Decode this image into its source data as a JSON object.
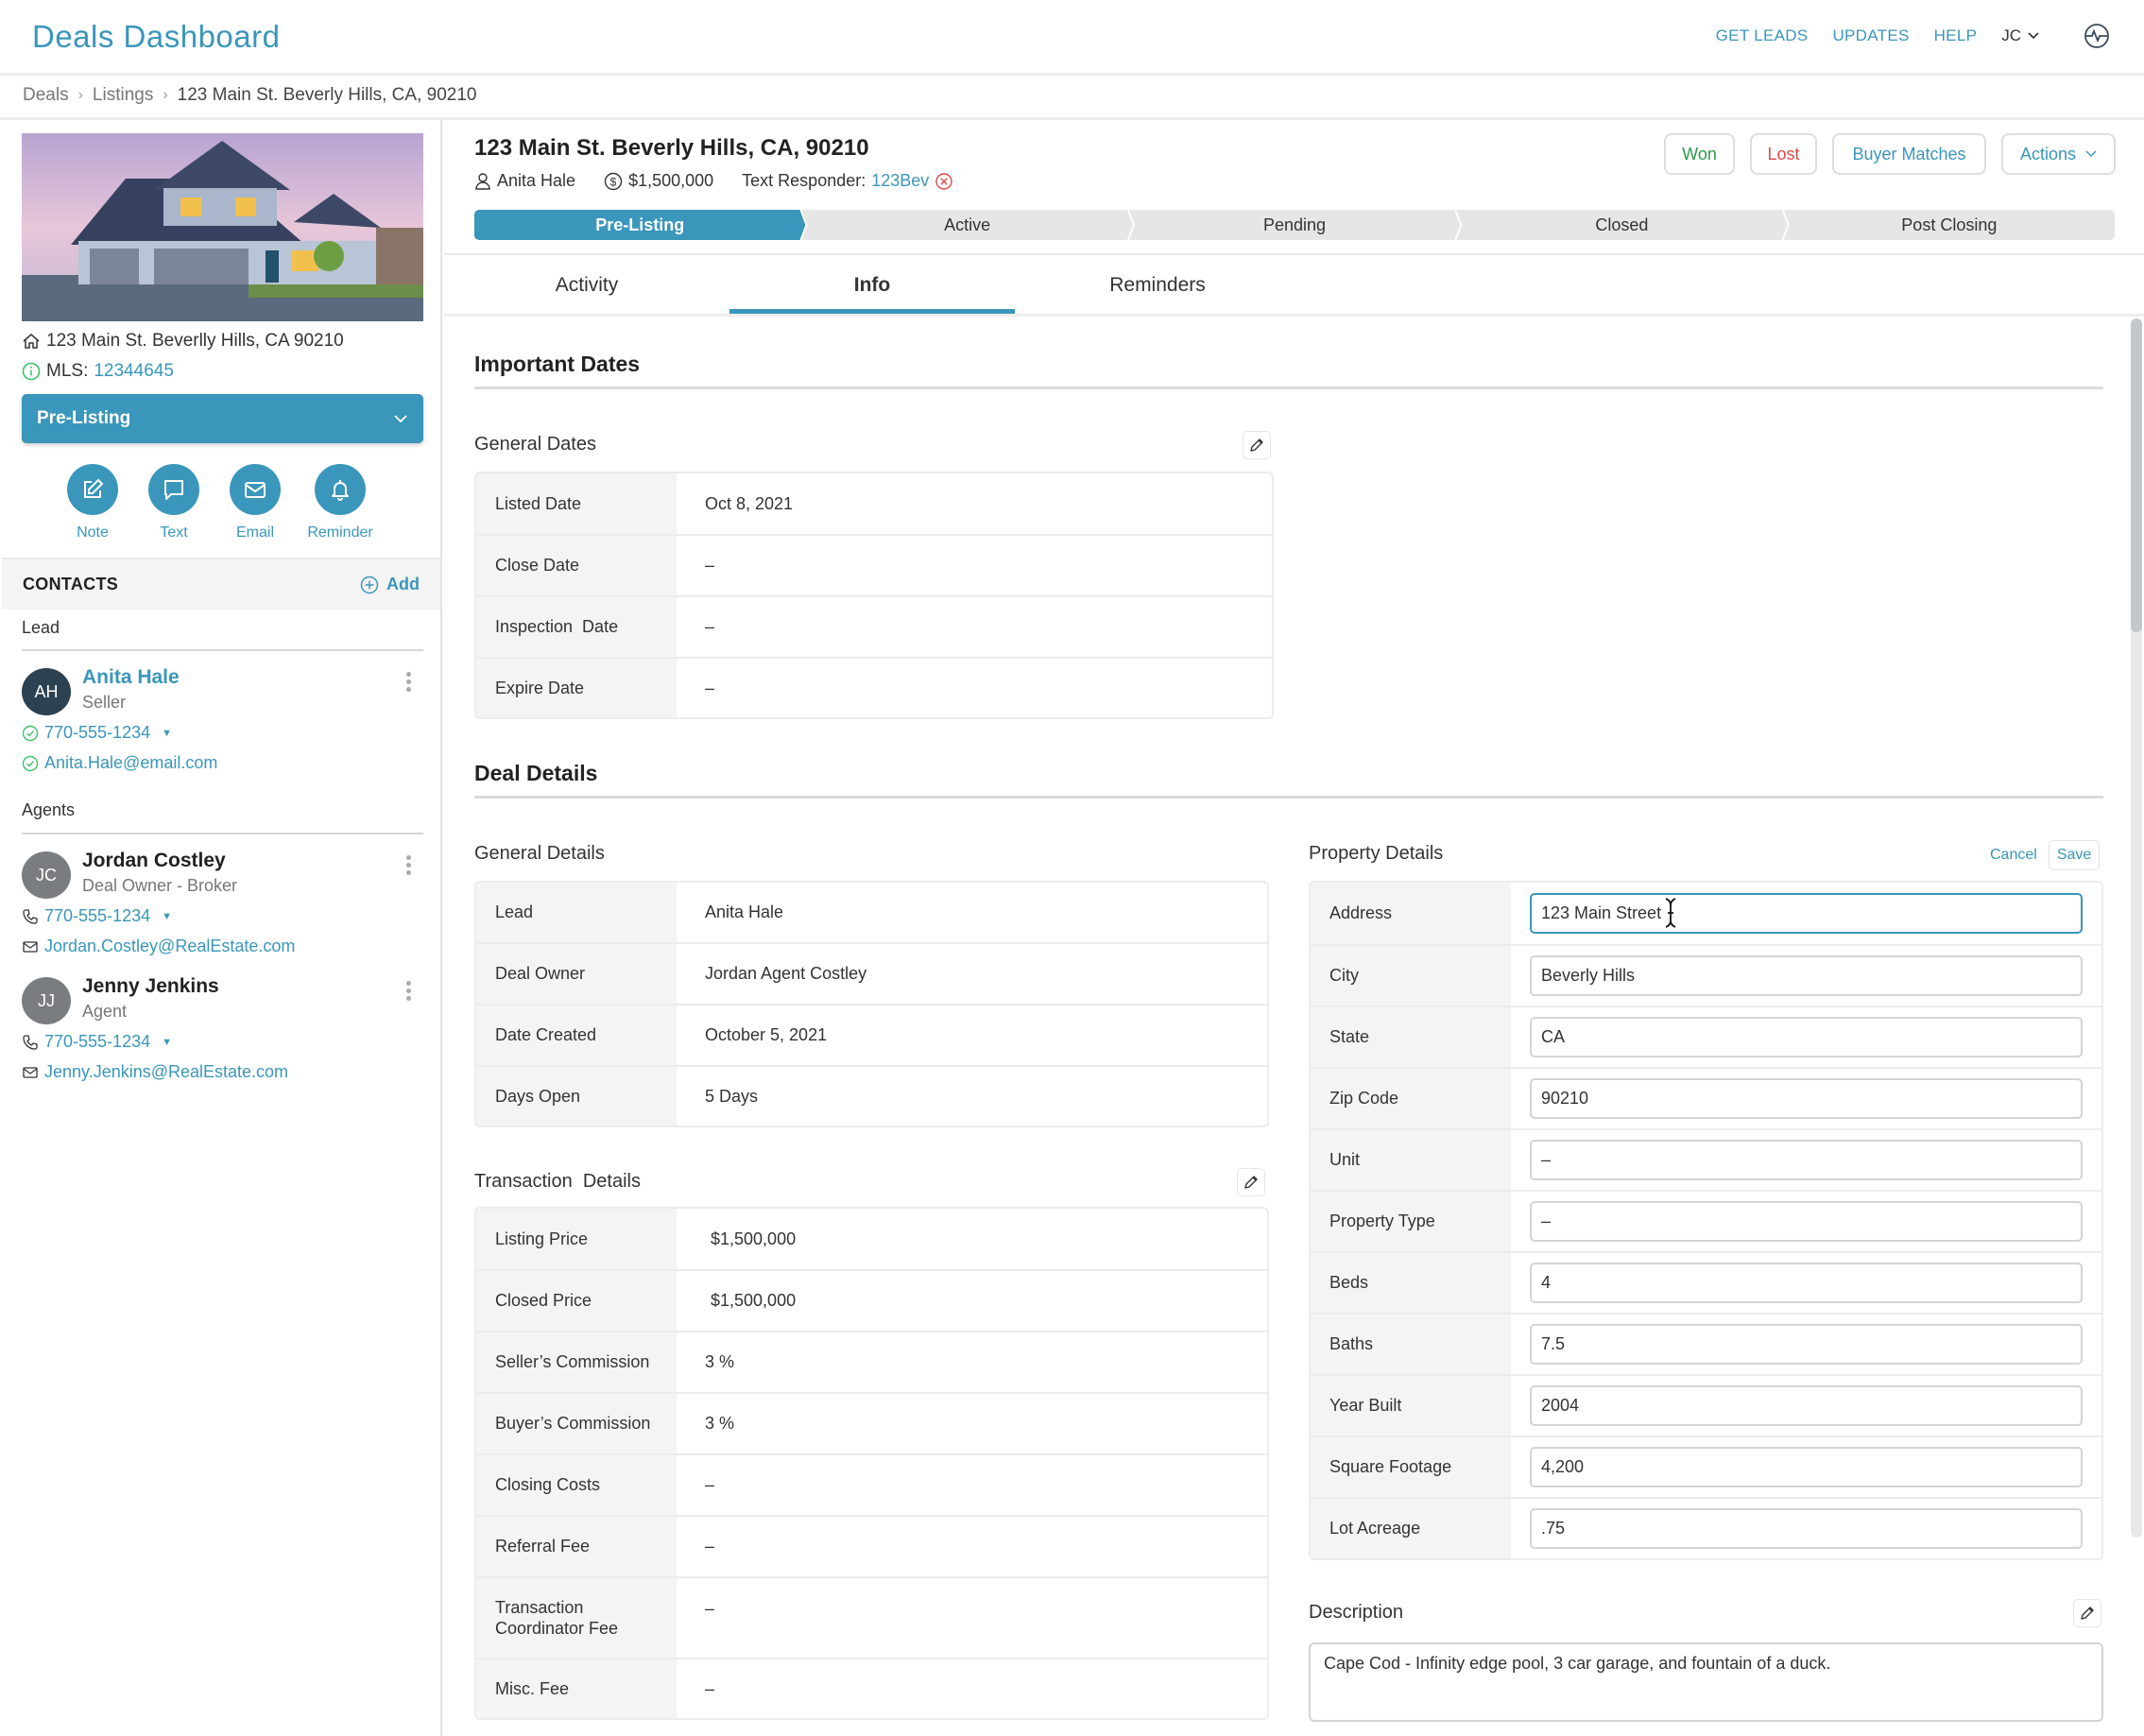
{
  "header": {
    "app_title": "Deals Dashboard",
    "nav": [
      "GET LEADS",
      "UPDATES",
      "HELP"
    ],
    "user_initials": "JC"
  },
  "breadcrumb": [
    "Deals",
    "Listings",
    "123 Main St. Beverly Hills, CA, 90210"
  ],
  "sidebar": {
    "address": "123 Main St. Beverlly Hills, CA 90210",
    "mls_label": "MLS:",
    "mls_number": "12344645",
    "stage_select": "Pre-Listing",
    "quick_actions": [
      "Note",
      "Text",
      "Email",
      "Reminder"
    ],
    "contacts_title": "CONTACTS",
    "add_label": "Add",
    "groups": {
      "lead": "Lead",
      "agents": "Agents"
    },
    "contacts": [
      {
        "initials": "AH",
        "name": "Anita Hale",
        "role": "Seller",
        "phone": "770-555-1234",
        "email": "Anita.Hale@email.com"
      },
      {
        "initials": "JC",
        "name": "Jordan Costley",
        "role": "Deal Owner - Broker",
        "phone": "770-555-1234",
        "email": "Jordan.Costley@RealEstate.com"
      },
      {
        "initials": "JJ",
        "name": "Jenny Jenkins",
        "role": "Agent",
        "phone": "770-555-1234",
        "email": "Jenny.Jenkins@RealEstate.com"
      }
    ]
  },
  "deal": {
    "title": "123 Main St. Beverly Hills, CA, 90210",
    "owner": "Anita Hale",
    "price": "$1,500,000",
    "text_responder_label": "Text Responder:",
    "text_responder_value": "123Bev",
    "buttons": {
      "won": "Won",
      "lost": "Lost",
      "matches": "Buyer Matches",
      "actions": "Actions"
    },
    "pipeline": [
      "Pre-Listing",
      "Active",
      "Pending",
      "Closed",
      "Post Closing"
    ],
    "active_stage": "Pre-Listing"
  },
  "tabs": [
    "Activity",
    "Info",
    "Reminders"
  ],
  "active_tab": "Info",
  "important_dates": {
    "title": "Important Dates",
    "general_dates_title": "General Dates",
    "rows": [
      {
        "label": "Listed Date",
        "value": "Oct 8, 2021"
      },
      {
        "label": "Close Date",
        "value": "–"
      },
      {
        "label": "Inspection  Date",
        "value": "–"
      },
      {
        "label": "Expire Date",
        "value": "–"
      }
    ]
  },
  "deal_details": {
    "title": "Deal Details",
    "general_title": "General Details",
    "general_rows": [
      {
        "label": "Lead",
        "value": "Anita Hale"
      },
      {
        "label": "Deal Owner",
        "value": "Jordan Agent Costley"
      },
      {
        "label": "Date Created",
        "value": "October 5, 2021"
      },
      {
        "label": "Days Open",
        "value": "5 Days"
      }
    ],
    "transaction_title": "Transaction  Details",
    "transaction_rows": [
      {
        "label": "Listing Price",
        "value": "$1,500,000"
      },
      {
        "label": "Closed Price",
        "value": "$1,500,000"
      },
      {
        "label": "Seller’s Commission",
        "value": "3 %"
      },
      {
        "label": "Buyer’s Commission",
        "value": "3 %"
      },
      {
        "label": "Closing Costs",
        "value": "–"
      },
      {
        "label": "Referral Fee",
        "value": "–"
      },
      {
        "label": "Transaction Coordinator Fee",
        "value": "–"
      },
      {
        "label": "Misc. Fee",
        "value": "–"
      }
    ],
    "property_title": "Property Details",
    "cancel_label": "Cancel",
    "save_label": "Save",
    "property_rows": [
      {
        "label": "Address",
        "value": "123 Main Street"
      },
      {
        "label": "City",
        "value": "Beverly Hills"
      },
      {
        "label": "State",
        "value": "CA"
      },
      {
        "label": "Zip Code",
        "value": "90210"
      },
      {
        "label": "Unit",
        "value": "–"
      },
      {
        "label": "Property Type",
        "value": "–"
      },
      {
        "label": "Beds",
        "value": "4"
      },
      {
        "label": "Baths",
        "value": "7.5"
      },
      {
        "label": "Year Built",
        "value": "2004"
      },
      {
        "label": "Square Footage",
        "value": "4,200"
      },
      {
        "label": "Lot Acreage",
        "value": ".75"
      }
    ],
    "description_title": "Description",
    "description": "Cape Cod - Infinity edge pool, 3 car garage, and fountain of a duck."
  },
  "colors": {
    "accent": "#3a96bb",
    "won": "#2c9b4a",
    "lost": "#e04848",
    "verified": "#3cc46a",
    "avatar_lead": "#2c4152",
    "avatar_agent": "#7a7d80"
  }
}
